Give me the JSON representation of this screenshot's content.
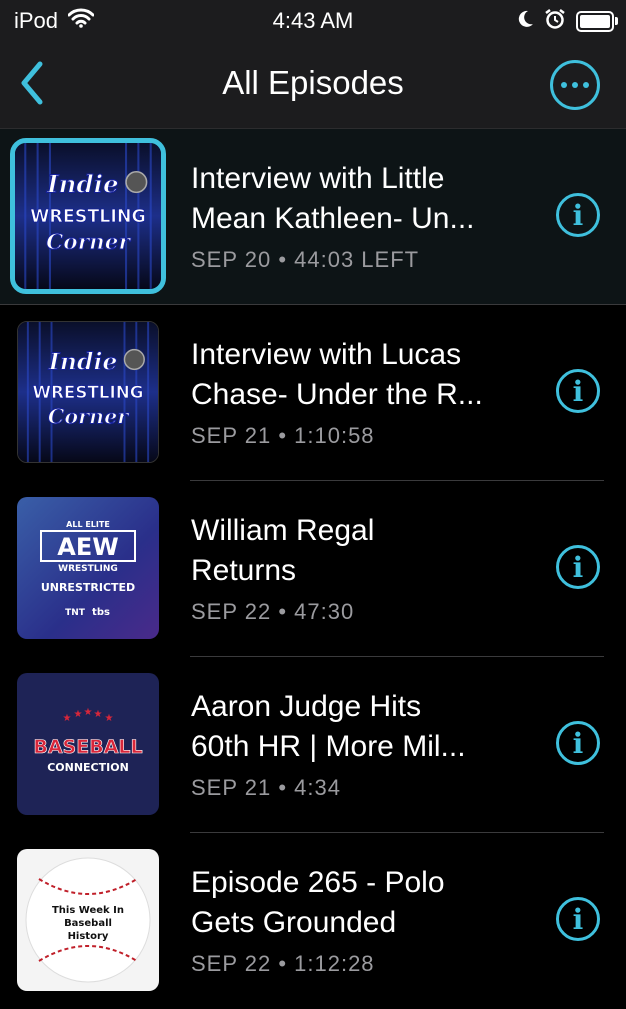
{
  "status": {
    "carrier": "iPod",
    "time": "4:43 AM"
  },
  "nav": {
    "title": "All Episodes"
  },
  "artwork_text": {
    "indie": [
      "Indie",
      "WRESTLING",
      "Corner"
    ],
    "aew": [
      "ALL ELITE",
      "AEW",
      "WRESTLING",
      "UNRESTRICTED",
      "TNT",
      "tbs"
    ],
    "baseball_connection": [
      "BASEBALL",
      "CONNECTION"
    ],
    "baseball_history": [
      "This Week In",
      "Baseball",
      "History"
    ]
  },
  "episodes": [
    {
      "title": "Interview with Little\nMean Kathleen- Un...",
      "meta": "SEP 20 • 44:03 LEFT",
      "artwork": "indie"
    },
    {
      "title": "Interview with Lucas\nChase- Under the R...",
      "meta": "SEP 21 • 1:10:58",
      "artwork": "indie"
    },
    {
      "title": "William Regal\nReturns",
      "meta": "SEP 22 • 47:30",
      "artwork": "aew"
    },
    {
      "title": "Aaron Judge Hits\n60th HR | More Mil...",
      "meta": "SEP 21 • 4:34",
      "artwork": "baseball_connection"
    },
    {
      "title": "Episode 265 - Polo\nGets Grounded",
      "meta": "SEP 22 • 1:12:28",
      "artwork": "baseball_history"
    }
  ],
  "colors": {
    "accent": "#3fc0dd",
    "background": "#000000",
    "bar": "#1c1c1e",
    "meta_text": "#9b9b9f"
  },
  "icons": [
    "wifi-icon",
    "moon-icon",
    "alarm-icon",
    "battery-icon",
    "chevron-left-icon",
    "ellipsis-icon",
    "info-icon"
  ]
}
